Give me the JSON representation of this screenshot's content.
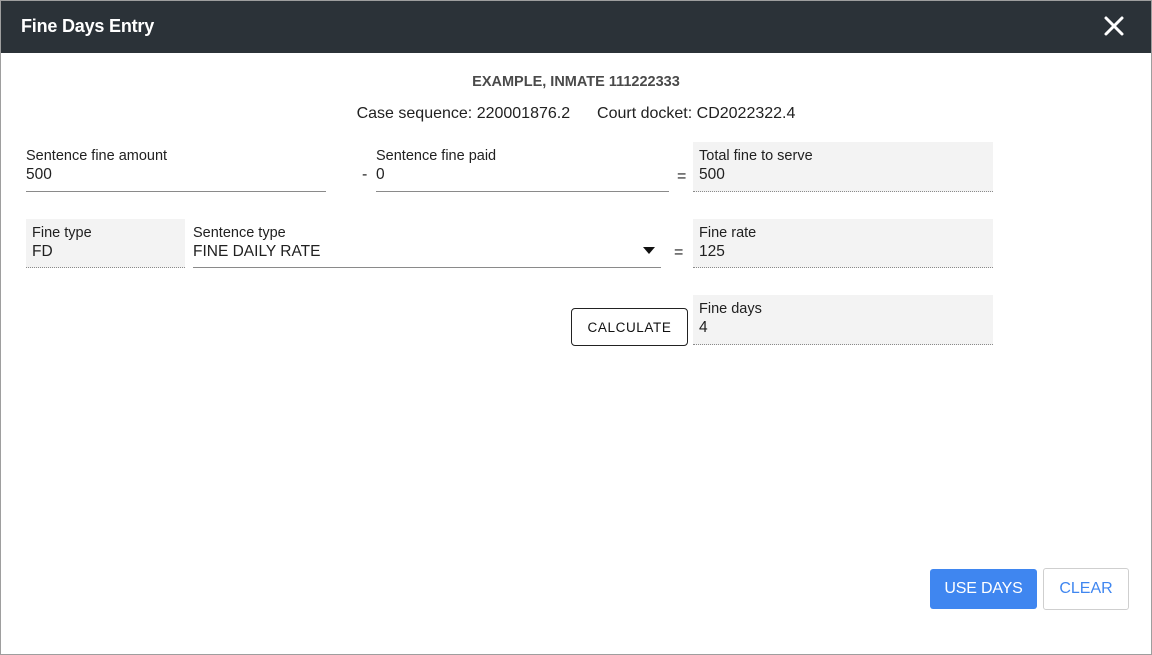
{
  "dialog": {
    "title": "Fine Days Entry",
    "close_icon": "close-icon"
  },
  "header": {
    "inmate": "EXAMPLE, INMATE 111222333",
    "case_sequence_label": "Case sequence:",
    "case_sequence_value": "220001876.2",
    "court_docket_label": "Court docket:",
    "court_docket_value": "CD2022322.4"
  },
  "form": {
    "sentence_fine_amount": {
      "label": "Sentence fine amount",
      "value": "500"
    },
    "minus_sign": "-",
    "sentence_fine_paid": {
      "label": "Sentence fine paid",
      "value": "0"
    },
    "equals_sign_1": "=",
    "total_fine_to_serve": {
      "label": "Total fine to serve",
      "value": "500"
    },
    "fine_type": {
      "label": "Fine type",
      "value": "FD"
    },
    "sentence_type": {
      "label": "Sentence type",
      "value": "FINE DAILY RATE",
      "icon": "caret-down-icon"
    },
    "equals_sign_2": "=",
    "fine_rate": {
      "label": "Fine rate",
      "value": "125"
    },
    "fine_days": {
      "label": "Fine days",
      "value": "4"
    }
  },
  "buttons": {
    "calculate": "CALCULATE",
    "use_days": "USE DAYS",
    "clear": "CLEAR"
  },
  "colors": {
    "titlebar": "#2b3238",
    "primary": "#3f86f0"
  }
}
